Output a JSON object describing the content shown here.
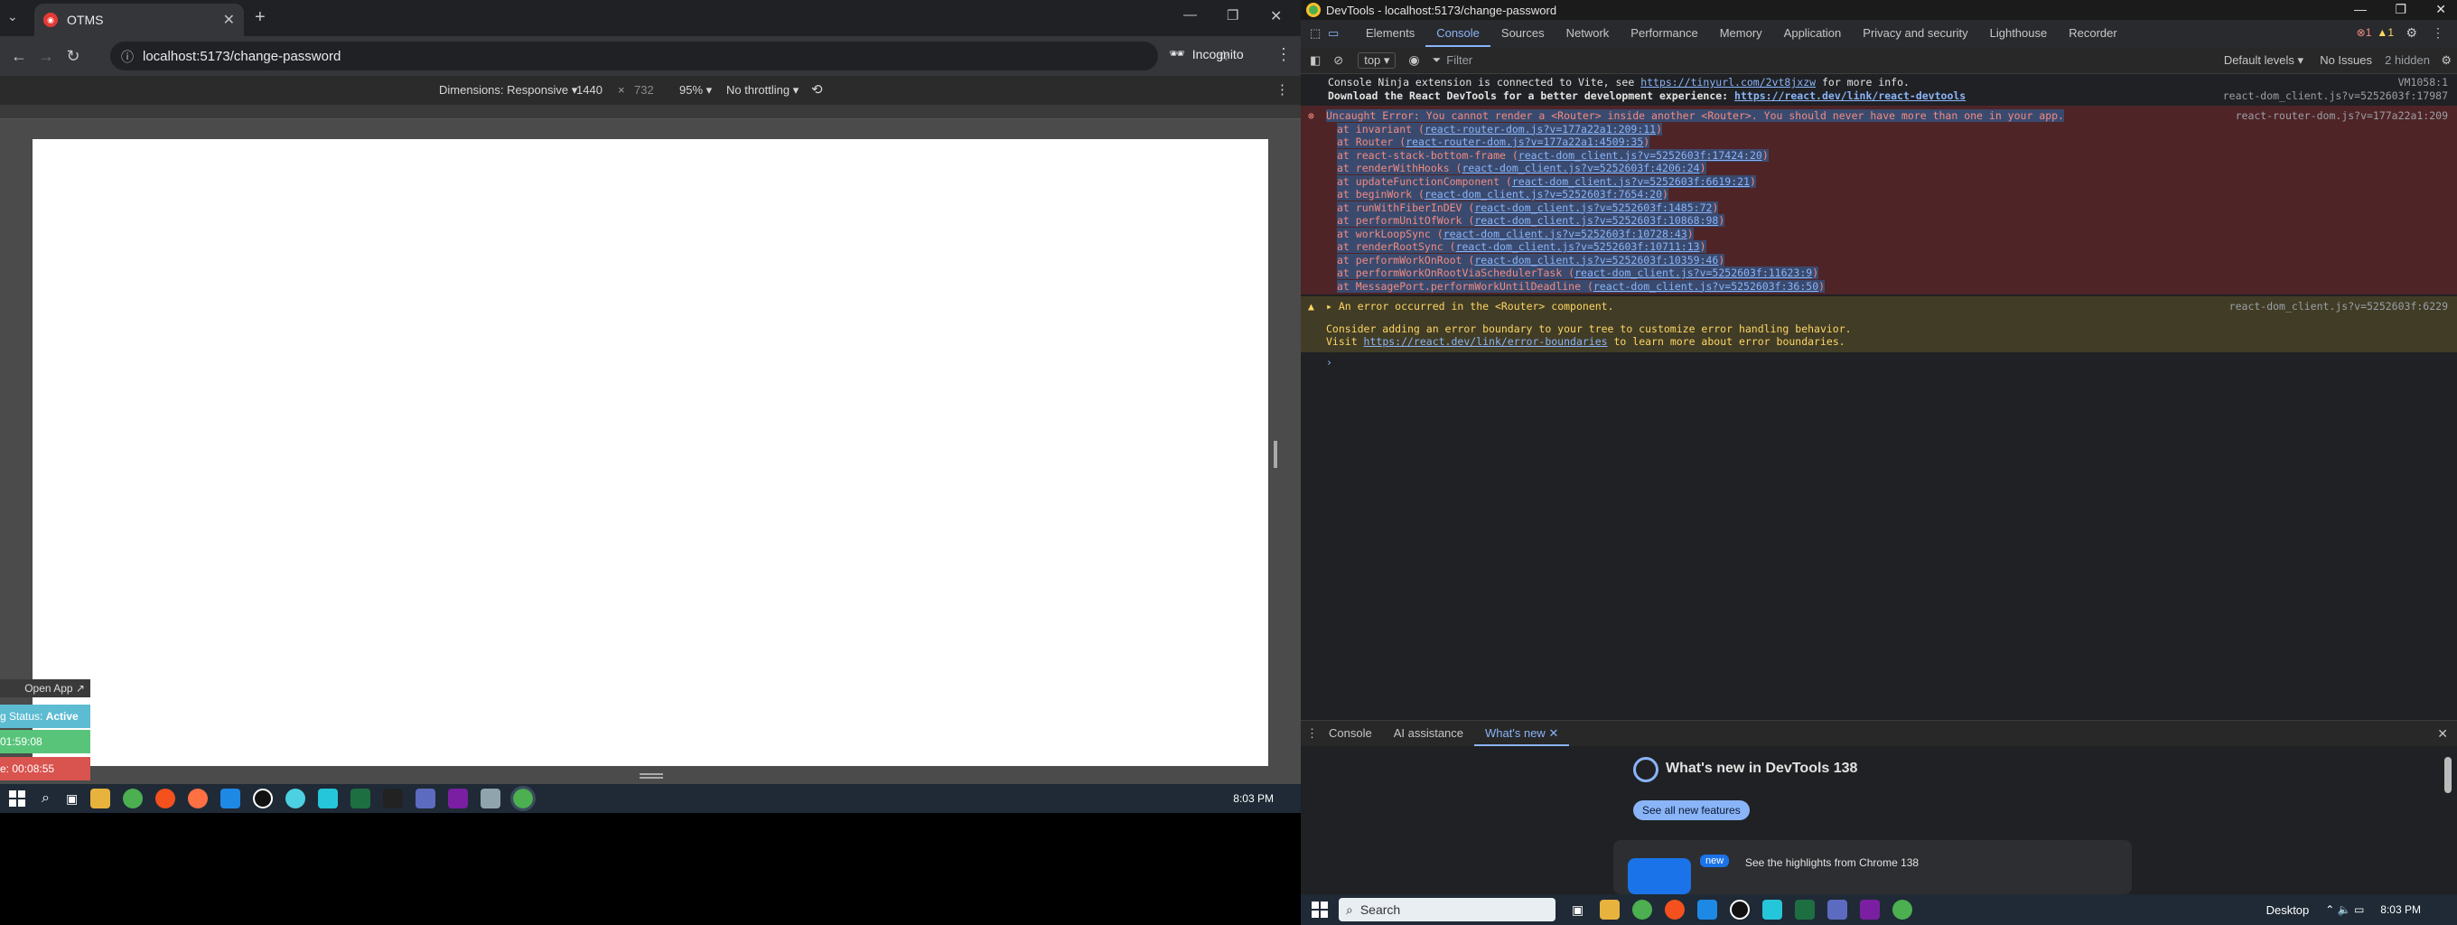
{
  "browser": {
    "tab_title": "OTMS",
    "url": "localhost:5173/change-password",
    "incognito_label": "Incognito"
  },
  "device_toolbar": {
    "dimensions_label": "Dimensions: Responsive",
    "width": "1440",
    "times": "×",
    "height": "732",
    "zoom": "95%",
    "throttle": "No throttling"
  },
  "widget": {
    "open_app": "Open App ↗",
    "status_prefix": "g Status: ",
    "status_value": "Active",
    "timer1": "01:59:08",
    "timer2": "e: 00:08:55"
  },
  "taskbar_left": {
    "time": "8:03 PM"
  },
  "devtools": {
    "title": "DevTools - localhost:5173/change-password",
    "tabs": [
      "Elements",
      "Console",
      "Sources",
      "Network",
      "Performance",
      "Memory",
      "Application",
      "Privacy and security",
      "Lighthouse",
      "Recorder"
    ],
    "error_count": "1",
    "warn_count": "1",
    "context": "top",
    "filter_placeholder": "Filter",
    "default_levels": "Default levels",
    "no_issues": "No Issues",
    "hidden": "2 hidden"
  },
  "console": {
    "ninja": {
      "text": "Console Ninja extension is connected to Vite, see ",
      "link": "https://tinyurl.com/2vt8jxzw",
      "tail": " for more info.",
      "src": "VM1058:1"
    },
    "react_dt": {
      "text": "Download the React DevTools for a better development experience: ",
      "link": "https://react.dev/link/react-devtools",
      "src": "react-dom_client.js?v=5252603f:17987"
    },
    "error": {
      "message": "Uncaught Error: You cannot render a <Router> inside another <Router>. You should never have more than one in your app.",
      "src": "react-router-dom.js?v=177a22a1:209",
      "stack": [
        {
          "fn": "at invariant (",
          "loc": "react-router-dom.js?v=177a22a1:209:11",
          "end": ")"
        },
        {
          "fn": "at Router (",
          "loc": "react-router-dom.js?v=177a22a1:4509:35",
          "end": ")"
        },
        {
          "fn": "at react-stack-bottom-frame (",
          "loc": "react-dom_client.js?v=5252603f:17424:20",
          "end": ")"
        },
        {
          "fn": "at renderWithHooks (",
          "loc": "react-dom_client.js?v=5252603f:4206:24",
          "end": ")"
        },
        {
          "fn": "at updateFunctionComponent (",
          "loc": "react-dom_client.js?v=5252603f:6619:21",
          "end": ")"
        },
        {
          "fn": "at beginWork (",
          "loc": "react-dom_client.js?v=5252603f:7654:20",
          "end": ")"
        },
        {
          "fn": "at runWithFiberInDEV (",
          "loc": "react-dom_client.js?v=5252603f:1485:72",
          "end": ")"
        },
        {
          "fn": "at performUnitOfWork (",
          "loc": "react-dom_client.js?v=5252603f:10868:98",
          "end": ")"
        },
        {
          "fn": "at workLoopSync (",
          "loc": "react-dom_client.js?v=5252603f:10728:43",
          "end": ")"
        },
        {
          "fn": "at renderRootSync (",
          "loc": "react-dom_client.js?v=5252603f:10711:13",
          "end": ")"
        },
        {
          "fn": "at performWorkOnRoot (",
          "loc": "react-dom_client.js?v=5252603f:10359:46",
          "end": ")"
        },
        {
          "fn": "at performWorkOnRootViaSchedulerTask (",
          "loc": "react-dom_client.js?v=5252603f:11623:9",
          "end": ")"
        },
        {
          "fn": "at MessagePort.performWorkUntilDeadline (",
          "loc": "react-dom_client.js?v=5252603f:36:50",
          "end": ")"
        }
      ]
    },
    "warning": {
      "message": "An error occurred in the <Router> component.",
      "src": "react-dom_client.js?v=5252603f:6229",
      "line2": "Consider adding an error boundary to your tree to customize error handling behavior.",
      "line3_pre": "Visit ",
      "line3_link": "https://react.dev/link/error-boundaries",
      "line3_post": " to learn more about error boundaries."
    },
    "prompt": "›"
  },
  "drawer": {
    "tabs": [
      "Console",
      "AI assistance",
      "What's new"
    ],
    "heading": "What's new in DevTools 138",
    "button": "See all new features",
    "new_badge": "new",
    "highlight": "See the highlights from Chrome 138"
  },
  "taskbar_right": {
    "search": "Search",
    "desktop": "Desktop",
    "time": "8:03 PM"
  }
}
